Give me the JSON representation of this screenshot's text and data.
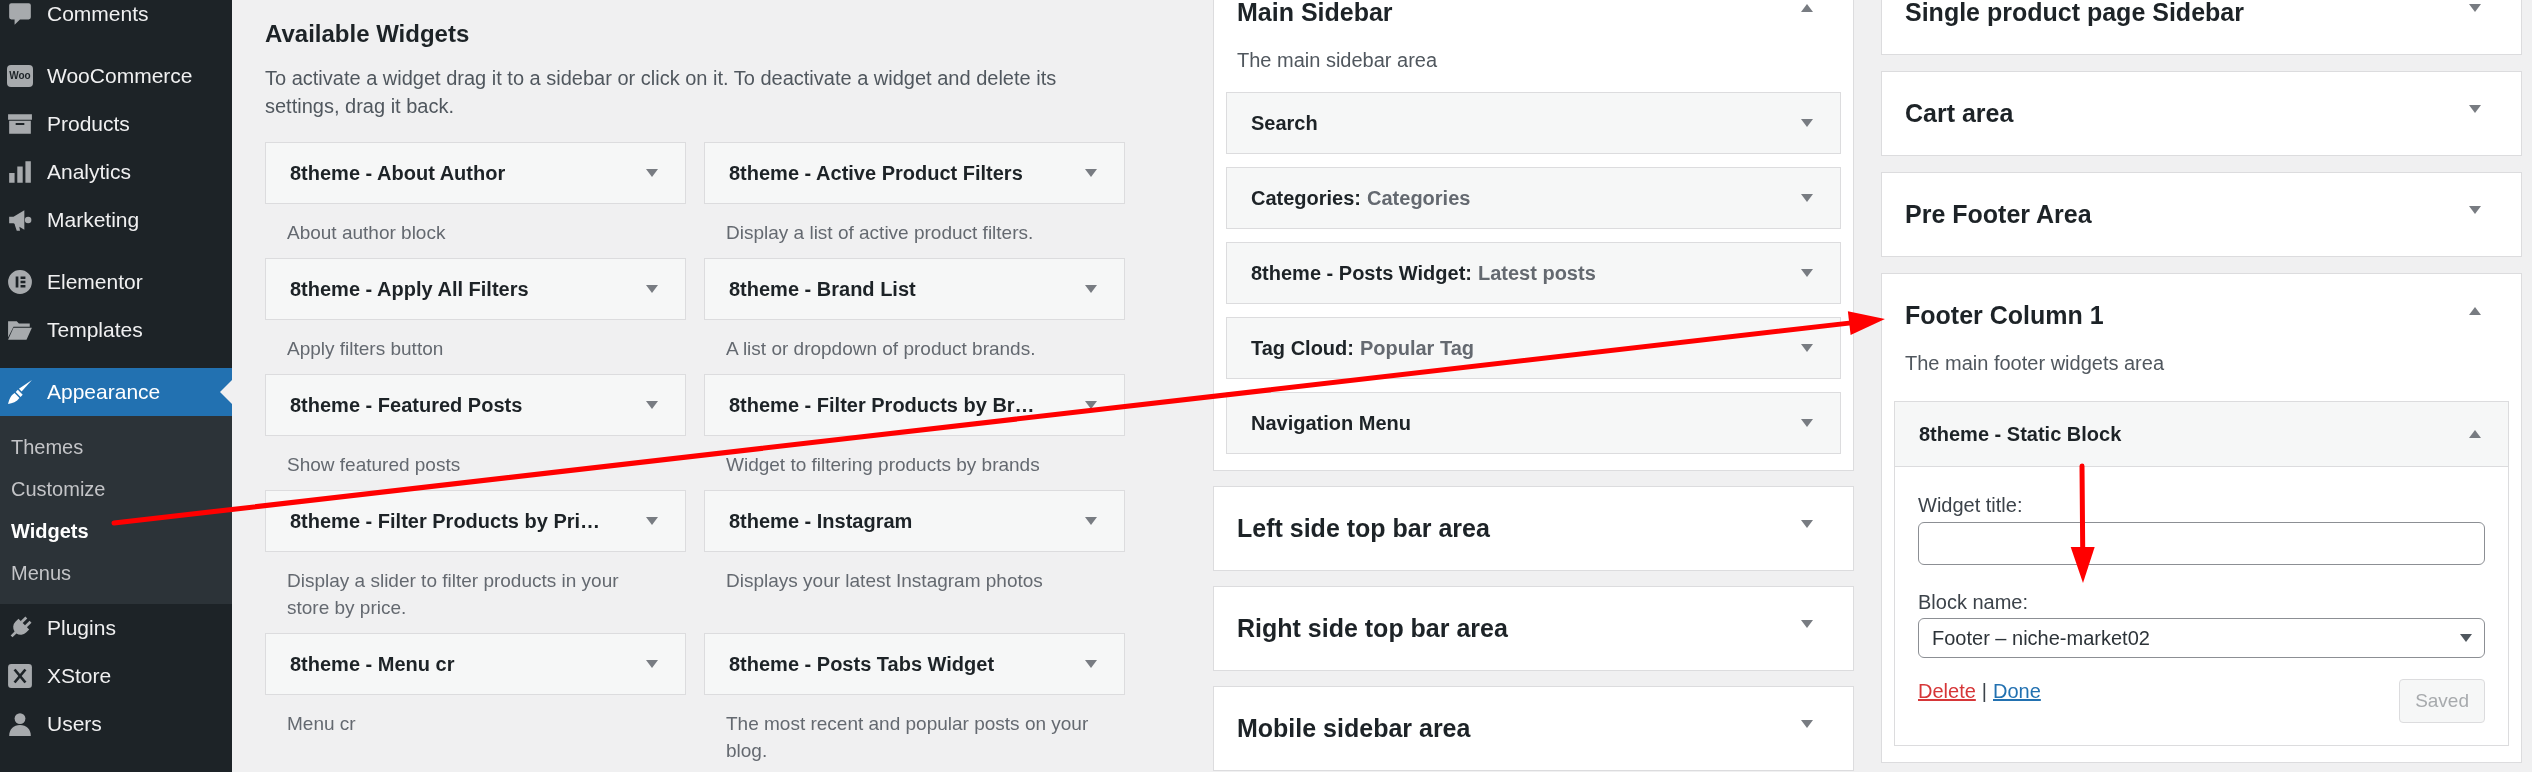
{
  "admin_menu": {
    "groups": [
      {
        "items": [
          {
            "label": "Comments",
            "selected": false
          }
        ]
      },
      {
        "items": [
          {
            "label": "WooCommerce",
            "selected": false,
            "icon_text": "Woo"
          },
          {
            "label": "Products",
            "selected": false
          },
          {
            "label": "Analytics",
            "selected": false
          },
          {
            "label": "Marketing",
            "selected": false
          }
        ]
      },
      {
        "items": [
          {
            "label": "Elementor",
            "selected": false
          },
          {
            "label": "Templates",
            "selected": false
          }
        ]
      },
      {
        "items": [
          {
            "label": "Appearance",
            "selected": true,
            "submenu": [
              {
                "label": "Themes",
                "selected": false
              },
              {
                "label": "Customize",
                "selected": false
              },
              {
                "label": "Widgets",
                "selected": true
              },
              {
                "label": "Menus",
                "selected": false
              }
            ]
          },
          {
            "label": "Plugins",
            "selected": false
          },
          {
            "label": "XStore",
            "selected": false
          },
          {
            "label": "Users",
            "selected": false
          }
        ]
      }
    ]
  },
  "available_widgets": {
    "title": "Available Widgets",
    "description": "To activate a widget drag it to a sidebar or click on it. To deactivate a widget and delete its settings, drag it back.",
    "widgets": [
      {
        "title": "8theme - About Author",
        "description": "About author block"
      },
      {
        "title": "8theme - Active Product Filters",
        "description": "Display a list of active product filters."
      },
      {
        "title": "8theme - Apply All Filters",
        "description": "Apply filters button"
      },
      {
        "title": "8theme - Brand List",
        "description": "A list or dropdown of product brands."
      },
      {
        "title": "8theme - Featured Posts",
        "description": "Show featured posts"
      },
      {
        "title": "8theme - Filter Products by Br…",
        "description": "Widget to filtering products by brands"
      },
      {
        "title": "8theme - Filter Products by Pri…",
        "description": "Display a slider to filter products in your store by price."
      },
      {
        "title": "8theme - Instagram",
        "description": "Displays your latest Instagram photos"
      },
      {
        "title": "8theme - Menu cr",
        "description": "Menu cr"
      },
      {
        "title": "8theme - Posts Tabs Widget",
        "description": "The most recent and popular posts on your blog."
      }
    ]
  },
  "sidebar_columns": [
    {
      "areas": [
        {
          "title": "Main Sidebar",
          "expanded": true,
          "description": "The main sidebar area",
          "widgets": [
            {
              "title": "Search",
              "expanded": false
            },
            {
              "title": "Categories:",
              "instance_title": "Categories",
              "expanded": false
            },
            {
              "title": "8theme - Posts Widget:",
              "instance_title": "Latest posts",
              "expanded": false
            },
            {
              "title": "Tag Cloud:",
              "instance_title": "Popular Tag",
              "expanded": false
            },
            {
              "title": "Navigation Menu",
              "expanded": false
            }
          ]
        },
        {
          "title": "Left side top bar area",
          "expanded": false
        },
        {
          "title": "Right side top bar area",
          "expanded": false
        },
        {
          "title": "Mobile sidebar area",
          "expanded": false
        }
      ]
    },
    {
      "areas": [
        {
          "title": "Single product page Sidebar",
          "expanded": false
        },
        {
          "title": "Cart area",
          "expanded": false
        },
        {
          "title": "Pre Footer Area",
          "expanded": false
        },
        {
          "title": "Footer Column 1",
          "expanded": true,
          "description": "The main footer widgets area",
          "widgets": [
            {
              "title": "8theme - Static Block",
              "expanded": true,
              "fields": [
                {
                  "kind": "text",
                  "label": "Widget title:"
                },
                {
                  "kind": "select",
                  "label": "Block name:",
                  "value": "Footer – niche-market02"
                }
              ],
              "links": [
                {
                  "kind": "delete",
                  "label": "Delete"
                },
                {
                  "kind": "done",
                  "label": "Done"
                }
              ],
              "link_separator": "|",
              "save_button": {
                "label": "Saved",
                "disabled": true
              }
            }
          ]
        }
      ]
    }
  ],
  "annotations": [
    {
      "kind": "arrow"
    },
    {
      "kind": "arrow"
    }
  ]
}
